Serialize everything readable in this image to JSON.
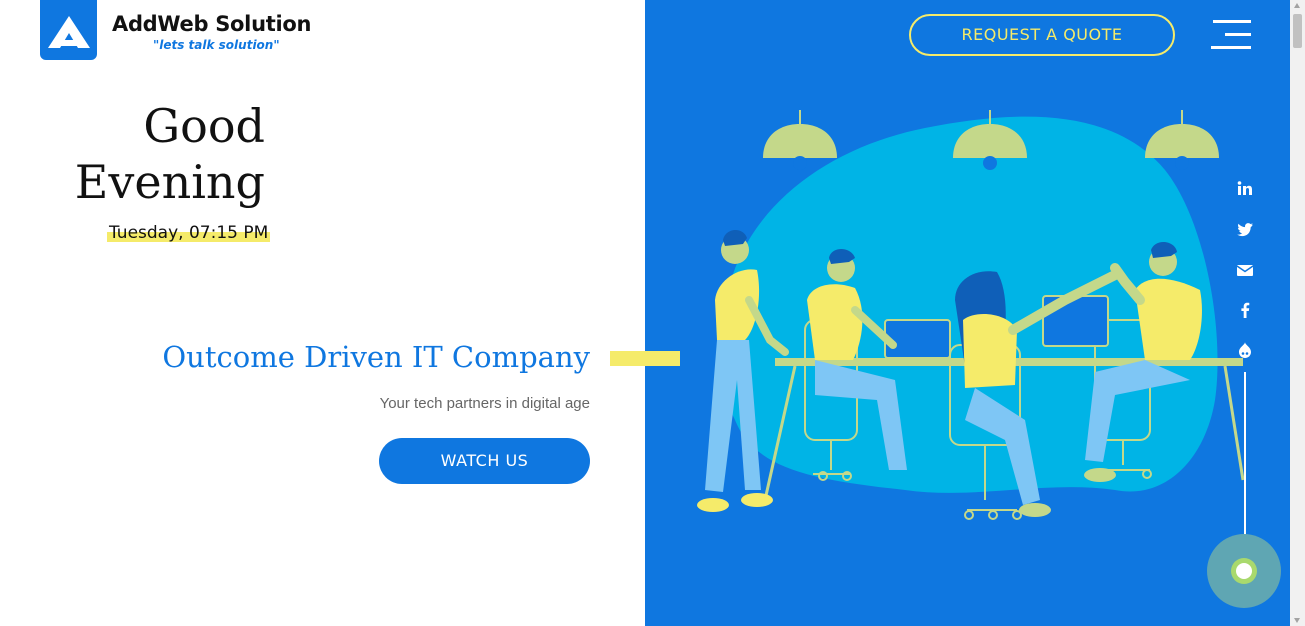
{
  "brand": {
    "name": "AddWeb Solution",
    "tagline": "\"lets talk solution\""
  },
  "greeting": {
    "line1": "Good",
    "line2": "Evening",
    "datetime": "Tuesday, 07:15 PM"
  },
  "hero": {
    "headline": "Outcome Driven IT Company",
    "subline": "Your tech partners in digital age",
    "cta_label": "WATCH US"
  },
  "header": {
    "quote_label": "REQUEST A QUOTE"
  },
  "social": [
    "linkedin-icon",
    "twitter-icon",
    "email-icon",
    "facebook-icon",
    "drupal-icon"
  ],
  "colors": {
    "brand_blue": "#0f77e0",
    "accent_yellow": "#f5eb6a",
    "light_blue": "#00b4e6",
    "lamp_green": "#c4d88a"
  }
}
